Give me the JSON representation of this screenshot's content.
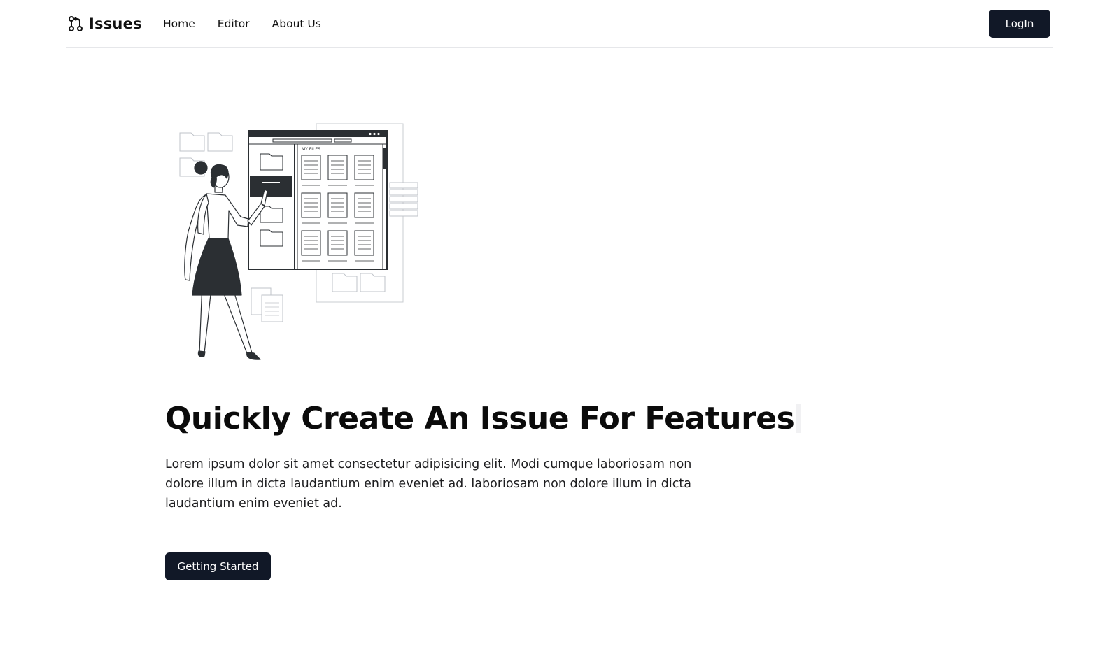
{
  "nav": {
    "brand_icon": "git-pull-request-icon",
    "brand_name": "Issues",
    "links": [
      "Home",
      "Editor",
      "About Us"
    ],
    "login_label": "LogIn"
  },
  "hero": {
    "illustration": "woman-file-manager-illustration",
    "illustration_label": "MY FILES",
    "title": "Quickly Create An Issue For Features",
    "description": "Lorem ipsum dolor sit amet consectetur adipisicing elit. Modi cumque laboriosam non dolore illum in dicta laudantium enim eveniet ad. laboriosam non dolore illum in dicta laudantium enim eveniet ad.",
    "cta_label": "Getting Started"
  },
  "colors": {
    "primary_button": "#111827",
    "text": "#111111",
    "divider": "#e6e7ea"
  }
}
